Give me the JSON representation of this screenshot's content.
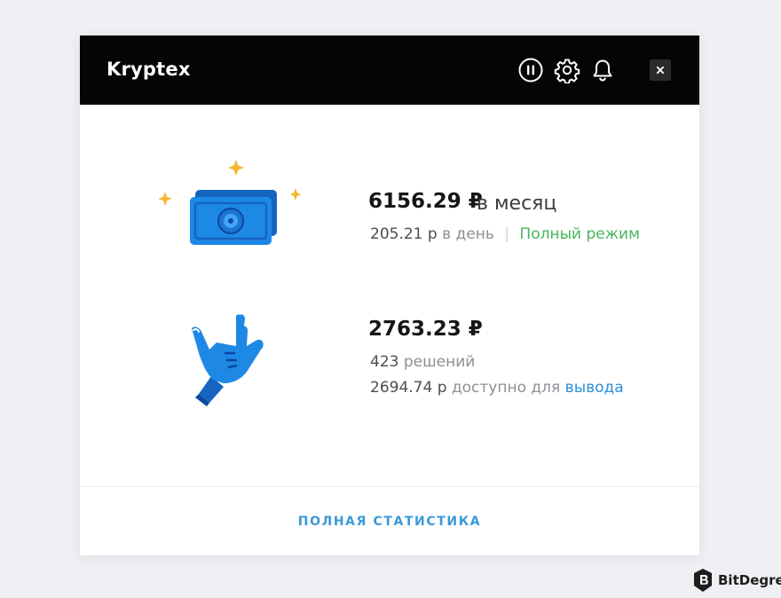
{
  "window": {
    "title": "Kryptex",
    "icons": [
      "pause-icon",
      "gear-icon",
      "bell-icon",
      "close-icon"
    ],
    "close_label": "×"
  },
  "monthly": {
    "amount": "6156.29 ₽",
    "period": "в месяц",
    "daily_value": "205.21 р",
    "daily_label": "в день",
    "separator": "|",
    "mode": "Полный режим"
  },
  "balance": {
    "amount": "2763.23 ₽",
    "solutions_count": "423",
    "solutions_label": "решений",
    "available_value": "2694.74 р",
    "available_label": "доступно для",
    "withdraw_link": "вывода"
  },
  "footer": {
    "stats_link": "ПОЛНАЯ СТАТИСТИКА"
  },
  "watermark": {
    "text": "BitDegree"
  },
  "colors": {
    "titlebar": "#050505",
    "accent_blue": "#2c8fd8",
    "mode_green": "#47b55c",
    "illustration_blue": "#1e88e5",
    "sparkle_yellow": "#f5b82e"
  }
}
